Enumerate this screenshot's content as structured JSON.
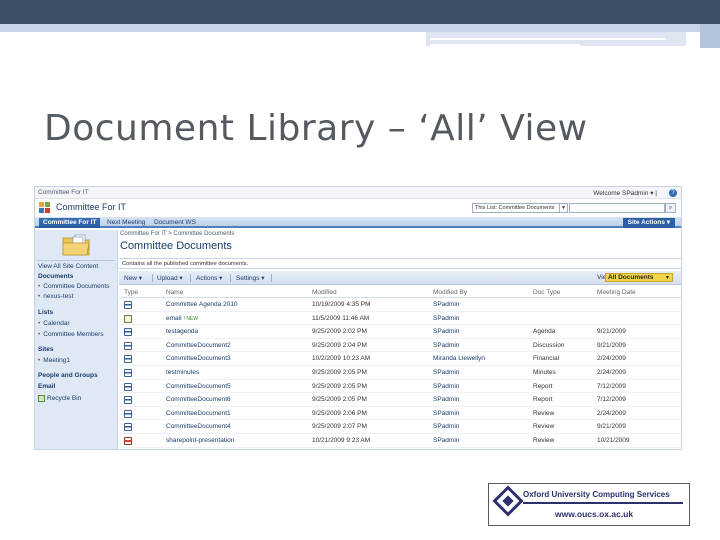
{
  "slide": {
    "title": "Document Library – ‘All’ View"
  },
  "sharepoint": {
    "top_crumb": "Committee For IT",
    "welcome": "Welcome SPadmin ▾ |",
    "help": "?",
    "site_title": "Committee For IT",
    "search_scope": "This List: Committee Documents",
    "nav_tabs": [
      {
        "label": "Committee For IT",
        "active": true
      },
      {
        "label": "Next Meeting",
        "active": false
      },
      {
        "label": "Document WS",
        "active": false
      }
    ],
    "site_actions": "Site Actions ▾",
    "sidebar": {
      "view_all": "View All Site Content",
      "documents_header": "Documents",
      "documents": [
        "Committee Documents",
        "nexus-test"
      ],
      "lists_header": "Lists",
      "lists": [
        "Calendar",
        "Committee Members"
      ],
      "sites_header": "Sites",
      "sites": [
        "Meeting1"
      ],
      "people_header": "People and Groups",
      "email_header": "Email",
      "recycle_bin": "Recycle Bin"
    },
    "breadcrumb": "Committee For IT > Committee Documents",
    "page_title": "Committee Documents",
    "description": "Contains all the published committee documents.",
    "toolbar": {
      "new": "New ▾",
      "upload": "Upload ▾",
      "actions": "Actions ▾",
      "settings": "Settings ▾",
      "view_label": "View:",
      "view_value": "All Documents"
    },
    "columns": [
      "Type",
      "Name",
      "Modified",
      "Modified By",
      "Doc Type",
      "Meeting Date"
    ],
    "rows": [
      {
        "icon": "word-doc-icon",
        "name": "Committee Agenda 2010",
        "modified": "10/19/2009 4:35 PM",
        "by": "SPadmin",
        "doctype": "",
        "meeting": ""
      },
      {
        "icon": "email-icon",
        "name": "email",
        "new": "! NEW",
        "modified": "11/5/2009 11:46 AM",
        "by": "SPadmin",
        "doctype": "",
        "meeting": ""
      },
      {
        "icon": "word-doc-icon",
        "name": "testagenda",
        "modified": "9/25/2009 2:02 PM",
        "by": "SPadmin",
        "doctype": "Agenda",
        "meeting": "9/21/2009"
      },
      {
        "icon": "word-doc-icon",
        "name": "CommitteeDocument2",
        "modified": "9/25/2009 2:04 PM",
        "by": "SPadmin",
        "doctype": "Discussion",
        "meeting": "9/21/2009"
      },
      {
        "icon": "word-doc-icon",
        "name": "CommitteeDocument3",
        "modified": "10/2/2009 10:23 AM",
        "by": "Miranda Llewellyn",
        "doctype": "Financial",
        "meeting": "2/24/2009"
      },
      {
        "icon": "word-doc-icon",
        "name": "testminutes",
        "modified": "9/25/2009 2:05 PM",
        "by": "SPadmin",
        "doctype": "Minutes",
        "meeting": "2/24/2009"
      },
      {
        "icon": "word-doc-icon",
        "name": "CommitteeDocument5",
        "modified": "9/25/2009 2:05 PM",
        "by": "SPadmin",
        "doctype": "Report",
        "meeting": "7/12/2009"
      },
      {
        "icon": "word-doc-icon",
        "name": "CommitteeDocument6",
        "modified": "9/25/2009 2:05 PM",
        "by": "SPadmin",
        "doctype": "Report",
        "meeting": "7/12/2009"
      },
      {
        "icon": "word-doc-icon",
        "name": "CommitteeDocument1",
        "modified": "9/25/2009 2:06 PM",
        "by": "SPadmin",
        "doctype": "Review",
        "meeting": "2/24/2009"
      },
      {
        "icon": "word-doc-icon",
        "name": "CommitteeDocument4",
        "modified": "9/25/2009 2:07 PM",
        "by": "SPadmin",
        "doctype": "Review",
        "meeting": "9/21/2009"
      },
      {
        "icon": "powerpoint-icon",
        "name": "sharepoint-presentation",
        "modified": "10/21/2009 9:23 AM",
        "by": "SPadmin",
        "doctype": "Review",
        "meeting": "10/21/2009"
      }
    ]
  },
  "logo": {
    "name": "Oxford University Computing Services",
    "url": "www.oucs.ox.ac.uk"
  },
  "colors": {
    "accent": "#2c5ea8",
    "view_selector": "#f5d34a",
    "logo_navy": "#2d2f6e"
  }
}
